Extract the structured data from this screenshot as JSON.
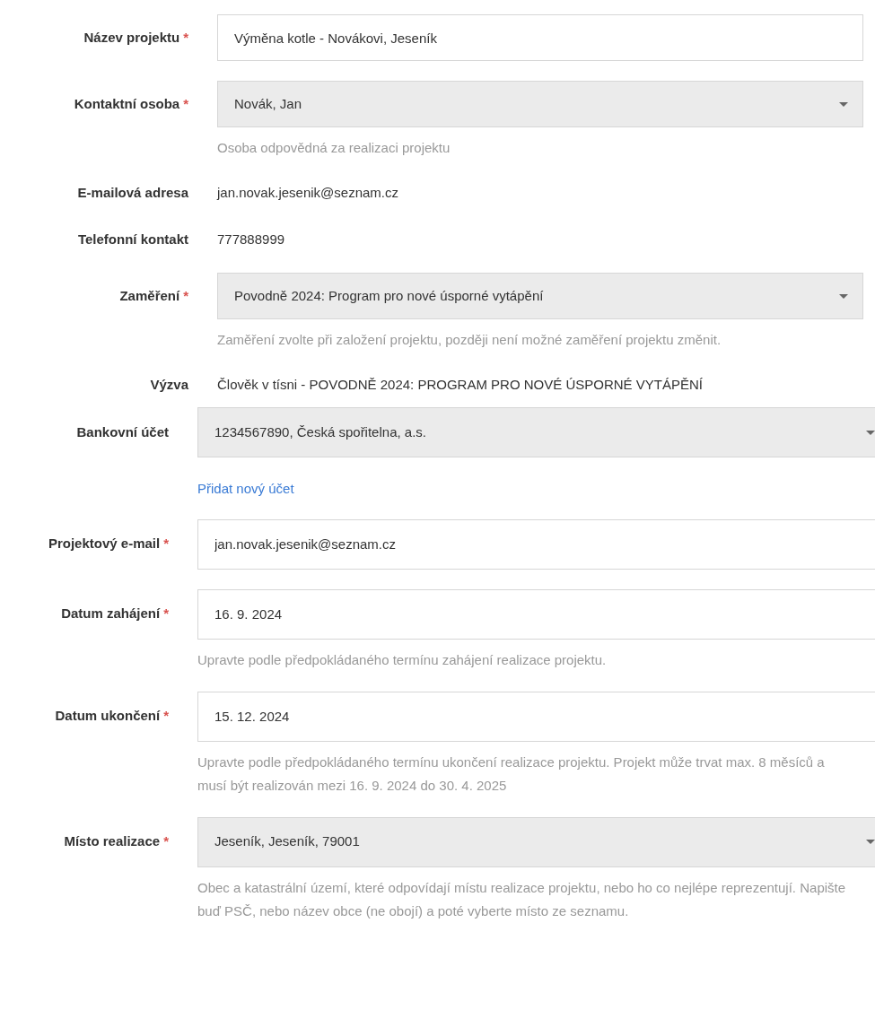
{
  "sections": [
    {
      "fields": [
        {
          "kind": "input",
          "label": "Název projektu",
          "required_mark": "*",
          "value": "Výměna kotle - Novákovi, Jeseník"
        },
        {
          "kind": "select",
          "label": "Kontaktní osoba",
          "required_mark": "*",
          "value": "Novák, Jan",
          "help": "Osoba odpovědná za realizaci projektu"
        },
        {
          "kind": "static",
          "label": "E-mailová adresa",
          "value": "jan.novak.jesenik@seznam.cz"
        },
        {
          "kind": "static",
          "label": "Telefonní kontakt",
          "value": "777888999"
        },
        {
          "kind": "select",
          "label": "Zaměření",
          "required_mark": "*",
          "value": "Povodně 2024: Program pro nové úsporné vytápění",
          "help": "Zaměření zvolte při založení projektu, později není možné zaměření projektu změnit."
        },
        {
          "kind": "static",
          "label": "Výzva",
          "value": "Člověk v tísni - POVODNĚ 2024: PROGRAM PRO NOVÉ ÚSPORNÉ VYTÁPĚNÍ"
        }
      ]
    },
    {
      "fields": [
        {
          "kind": "select",
          "label": "Bankovní účet",
          "value": "1234567890, Česká spořitelna, a.s.",
          "link": "Přidat nový účet"
        },
        {
          "kind": "input",
          "label": "Projektový e-mail",
          "required_mark": "*",
          "value": "jan.novak.jesenik@seznam.cz"
        },
        {
          "kind": "input",
          "label": "Datum zahájení",
          "required_mark": "*",
          "value": "16. 9. 2024",
          "help": "Upravte podle předpokládaného termínu zahájení realizace projektu."
        },
        {
          "kind": "input",
          "label": "Datum ukončení",
          "required_mark": "*",
          "value": "15. 12. 2024",
          "help": "Upravte podle předpokládaného termínu ukončení realizace projektu. Projekt může trvat max. 8 měsíců a musí být realizován mezi 16. 9. 2024 do 30. 4. 2025"
        },
        {
          "kind": "select",
          "label": "Místo realizace",
          "required_mark": "*",
          "value": "Jeseník, Jeseník, 79001",
          "help": "Obec a katastrální území, které odpovídají místu realizace projektu, nebo ho co nejlépe reprezentují. Napište buď PSČ, nebo název obce (ne obojí) a poté vyberte místo ze seznamu."
        }
      ]
    }
  ]
}
